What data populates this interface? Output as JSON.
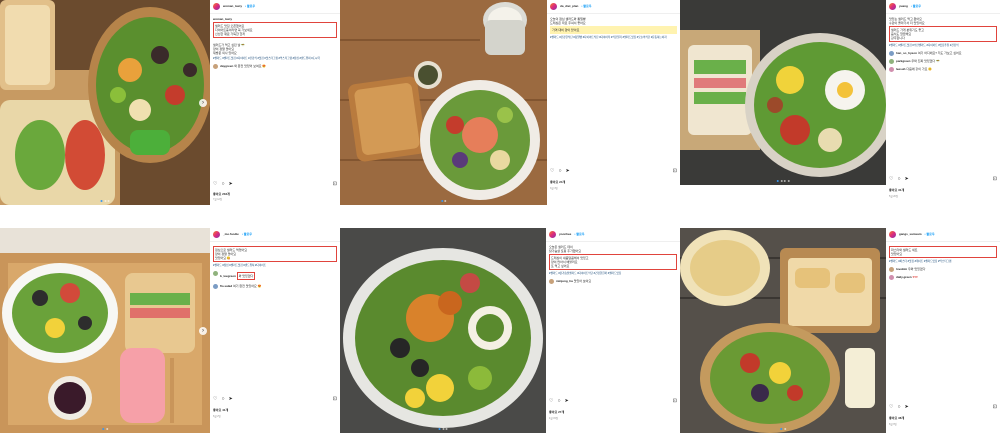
{
  "posts": [
    {
      "user": "woman_tasty",
      "follow": "• 팔로우",
      "caption_box": "샐러드 맛집 오픈했어요\n다이어트중이라면 꼭 가보세요\n신선한 재료 가득한 한끼",
      "caption": "\n샐러드가 먹고 싶던 날 🥗\n양이 정말 많아요\n재방문 의사 있어요",
      "tags": "#샐러드 #샐러드맛집 #다이어트 #건강식 #맛집 #맛스타그램 #먹스타그램 #점심 #샌드위치 #도시락",
      "comments": [
        {
          "user": "daygreen",
          "text": "와 완전 맛있어 보여요 😍"
        }
      ],
      "likes": "좋아요 232개",
      "date": "7월 12일"
    },
    {
      "user": "da_diet_plan",
      "follow": "• 팔로우",
      "caption": "오늘의 점심 샐러드와 통밀빵\n드레싱은 따로 주셔서 좋아요",
      "caption_box": "가격 대비 양이 많아요",
      "tags": "#샐러드 #건강한식단 #통밀빵 #다이어트식단 #다이어터 #식단일기 #샐러드맛집 #오늘의식단 #운동하는여자",
      "comments": [],
      "likes": "좋아요 24개",
      "date": "3월 4일"
    },
    {
      "user": "yuang",
      "follow": "• 팔로우",
      "caption": "맛있는 샐러드 먹고 왔어요\n수란이 올라가서 더 맛있어요",
      "caption_box": "샐러드 가게 분위기도 좋고\n음식도 깔끔해요\n강추합니다",
      "tags": "#샐러드 #샐러드맛집 #수란샐러드 #다이어트 #맛집추천 #건강식",
      "comments": [
        {
          "user": "han_so_hyeon",
          "text": "여기 어디에요? 저도 가보고 싶어요"
        },
        {
          "user": "parkgreen",
          "text": "우와 진짜 맛있겠다 🥗"
        },
        {
          "user": "leesuh",
          "text": "다음에 같이 가요 😊"
        }
      ],
      "likes": "좋아요 31개",
      "date": "5월 20일"
    },
    {
      "user": "_me.foodie",
      "follow": "• 팔로우",
      "caption_box": "점심으로 샐러드 먹었어요\n양이 정말 많아요\n맛있어요 😋",
      "caption": "",
      "tags": "#샐러드 #점심 #샐러드맛집 #샌드위치 #다이어트",
      "comments": [
        {
          "user": "b_leegreen",
          "text": "와 맛있겠다"
        },
        {
          "user": "flo.salad",
          "text": "여기 완전 맛있어요 😍"
        }
      ],
      "likes": "좋아요 41개",
      "date": "6월 2일"
    },
    {
      "user": "yoonhee",
      "follow": "• 팔로우",
      "caption": "오늘은 샐러드 데이\n닭가슴살 토핑 추가했어요",
      "caption_box": "드레싱이 새콤달콤해서 맛있고\n양이 많아서 배불러요\n또 먹고 싶어요",
      "tags": "#샐러드 #닭가슴살샐러드 #다이어트식단 #건강한한끼 #샐러드맛집",
      "comments": [
        {
          "user": "minjung_ha",
          "text": "맛있어 보여요"
        }
      ],
      "likes": "좋아요 27개",
      "date": "4월 15일"
    },
    {
      "user": "gangs_samsam",
      "follow": "• 팔로우",
      "caption": "",
      "caption_box": "파스타와 샐러드 세트\n맛있어요",
      "tags": "#샐러드 #파스타 #맛집 #데이트 #샐러드맛집 #먹스타그램",
      "comments": [
        {
          "user": "lovekim",
          "text": "우와 맛있겠다"
        },
        {
          "user": "daily.green",
          "text": "♥♥♥"
        }
      ],
      "likes": "좋아요 38개",
      "date": "8월 9일"
    }
  ],
  "icons": {
    "like": "♡",
    "comment": "○",
    "share": "➤",
    "save": "⊡",
    "next": "›",
    "prev": "‹"
  }
}
